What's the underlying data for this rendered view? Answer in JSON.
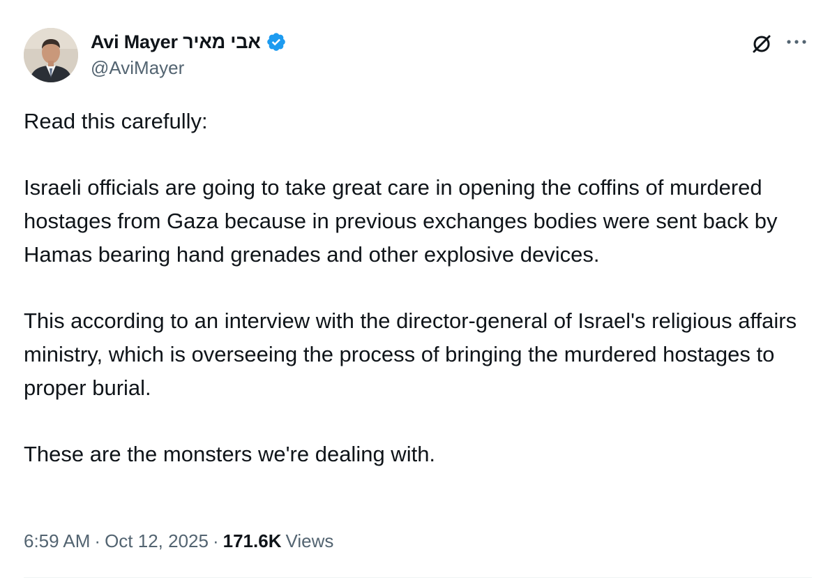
{
  "author": {
    "display_name": "Avi Mayer אבי מאיר",
    "handle": "@AviMayer",
    "verified": true
  },
  "icons": {
    "verified": "verified-badge-icon",
    "grok": "grok-icon",
    "more": "more-options-icon"
  },
  "tweet": {
    "paragraphs": [
      "Read this carefully:",
      "Israeli officials are going to take great care in opening the coffins of murdered hostages from Gaza because in previous exchanges bodies were sent back by Hamas bearing hand grenades and other explosive devices.",
      "This according to an interview with the director-general of Israel's religious affairs ministry, which is overseeing the process of bringing the murdered hostages to proper burial.",
      "These are the monsters we're dealing with."
    ]
  },
  "meta": {
    "time": "6:59 AM",
    "separator": "·",
    "date": "Oct 12, 2025",
    "views_count": "171.6K",
    "views_label": "Views"
  },
  "colors": {
    "text": "#0f1419",
    "secondary": "#536471",
    "verified": "#1d9bf0",
    "divider": "#eff3f4"
  }
}
